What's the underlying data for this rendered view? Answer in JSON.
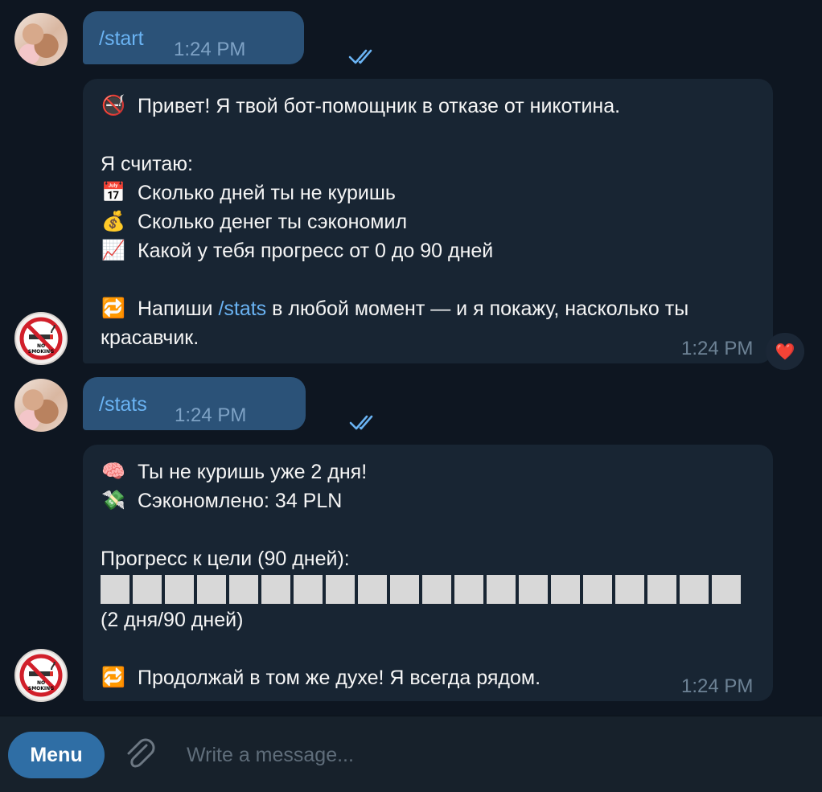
{
  "messages": {
    "m1": {
      "text": "/start",
      "time": "1:24 PM"
    },
    "m2": {
      "lines": [
        "Привет! Я твой бот-помощник в отказе от никотина.",
        "Я считаю:",
        "Сколько дней ты не куришь",
        "Сколько денег ты сэкономил",
        "Какой у тебя прогресс от 0 до 90 дней",
        "Напиши",
        "/stats",
        "в любой момент — и я покажу, насколько ты",
        "красавчик."
      ],
      "time": "1:24 PM",
      "reaction": "❤️"
    },
    "m3": {
      "text": "/stats",
      "time": "1:24 PM"
    },
    "m4": {
      "lines": [
        "Ты не куришь уже 2 дня!",
        "Сэкономлено: 34 PLN",
        "Прогресс к цели (90 дней):",
        "(2 дня/90 дней)",
        "Продолжай в том же духе! Я всегда рядом."
      ],
      "time": "1:24 PM",
      "progress_blocks": 20
    }
  },
  "icons": {
    "no_smoking": "🚭",
    "calendar": "📅",
    "money_bag": "💰",
    "chart": "📈",
    "repeat": "🔁",
    "brain": "🧠",
    "money_wings": "💸"
  },
  "composer": {
    "menu_label": "Menu",
    "placeholder": "Write a message..."
  },
  "colors": {
    "background": "#0e1621",
    "incoming_bubble": "#182533",
    "outgoing_bubble": "#2b5278",
    "link": "#6ab3f3",
    "menu_button": "#2f6ea5"
  }
}
